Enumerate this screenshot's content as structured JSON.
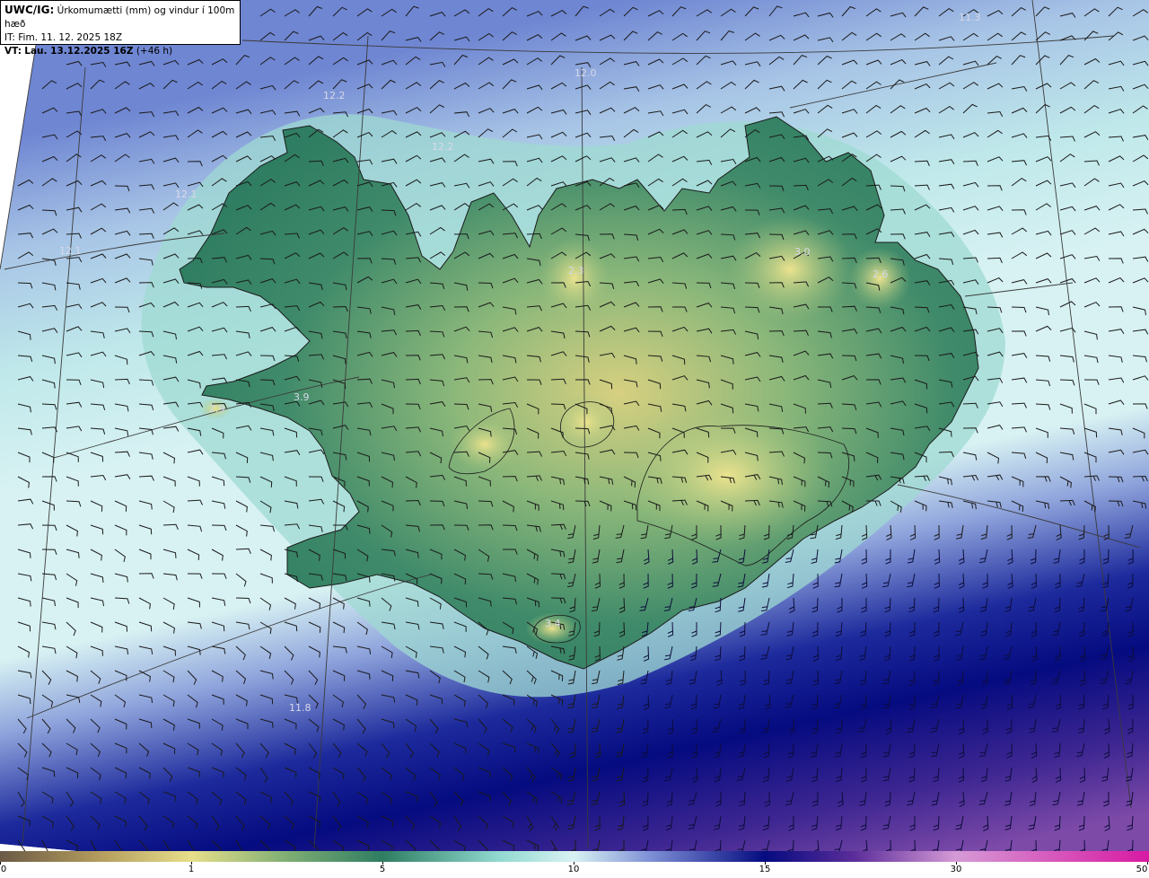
{
  "title": {
    "model": "UWC/IG:",
    "field": "Úrkomumætti (mm) og vindur í 100m hæð",
    "it_prefix": "IT:",
    "it_value": "Fim. 11. 12. 2025 18Z",
    "vt_prefix": "VT:",
    "vt_value": "Lau. 13.12.2025 16Z",
    "vt_lead": "(+46 h)"
  },
  "colorbar": {
    "labels": [
      {
        "text": "0",
        "value": 0
      },
      {
        "text": "1",
        "value": 1
      },
      {
        "text": "5",
        "value": 5
      },
      {
        "text": "10",
        "value": 10
      },
      {
        "text": "15",
        "value": 15
      },
      {
        "text": "30",
        "value": 30
      },
      {
        "text": "50",
        "value": 50
      }
    ],
    "stops": [
      {
        "value": 0,
        "color": "#6b5a46"
      },
      {
        "value": 0.5,
        "color": "#b19a5c"
      },
      {
        "value": 1,
        "color": "#e7df8a"
      },
      {
        "value": 3,
        "color": "#7fae74"
      },
      {
        "value": 5,
        "color": "#2f7d62"
      },
      {
        "value": 8,
        "color": "#8fd8cf"
      },
      {
        "value": 10,
        "color": "#d8f2f3"
      },
      {
        "value": 12,
        "color": "#7e90d6"
      },
      {
        "value": 15,
        "color": "#050b80"
      },
      {
        "value": 22,
        "color": "#5b2d9a"
      },
      {
        "value": 30,
        "color": "#d59ad6"
      },
      {
        "value": 50,
        "color": "#d81aa3"
      }
    ]
  },
  "map_labels": [
    {
      "text": "11.3"
    },
    {
      "text": "12.0"
    },
    {
      "text": "12.2"
    },
    {
      "text": "12.2"
    },
    {
      "text": "12.1"
    },
    {
      "text": "12.1"
    },
    {
      "text": "3.0"
    },
    {
      "text": "2.6"
    },
    {
      "text": "2.3"
    },
    {
      "text": "3.9"
    },
    {
      "text": "2.9"
    },
    {
      "text": "3.4"
    },
    {
      "text": "11.8"
    }
  ],
  "colors": {
    "sea_south": "#050b80",
    "sea_mid": "#d8f2f3",
    "land_green": "#2f7d62",
    "land_yellow": "#e7df8a",
    "sea_north": "#7e90d6"
  }
}
